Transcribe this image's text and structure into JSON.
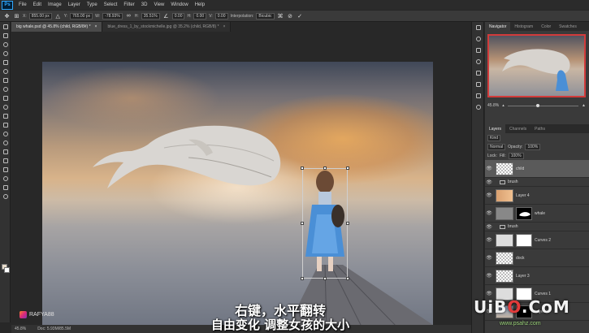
{
  "app": {
    "logo": "Ps",
    "accent": "#31a8ff"
  },
  "menu": [
    "File",
    "Edit",
    "Image",
    "Layer",
    "Type",
    "Select",
    "Filter",
    "3D",
    "View",
    "Window",
    "Help"
  ],
  "options": {
    "x_label": "X:",
    "x_value": "855.00 px",
    "y_label": "Y:",
    "y_value": "765.00 px",
    "w_label": "W:",
    "w_value": "-78.93%",
    "h_label": "H:",
    "h_value": "35.51%",
    "angle_value": "0.00",
    "h_skew_label": "H:",
    "h_skew_value": "0.00",
    "v_skew_label": "V:",
    "v_skew_value": "0.00",
    "interpolation_label": "Interpolation:",
    "interpolation_value": "Bicubic"
  },
  "doc_tabs": [
    {
      "label": "big whale.psd @ 45.8% (child, RGB/8#) *",
      "close": "×"
    },
    {
      "label": "blue_dress_1_by_stockmichelle.jpg @ 35.2% (child, RGB/8) *",
      "close": "×"
    }
  ],
  "panel_tabs_top": [
    "Navigator",
    "Histogram",
    "Color",
    "Swatches"
  ],
  "navigator": {
    "zoom": "45.8%"
  },
  "panel_tabs_layers": [
    "Layers",
    "Channels",
    "Paths"
  ],
  "layers_panel": {
    "kind": "Kind",
    "blend": "Normal",
    "opacity_label": "Opacity:",
    "opacity": "100%",
    "lock_label": "Lock:",
    "fill_label": "Fill:",
    "fill": "100%"
  },
  "layers": [
    {
      "name": "child",
      "kind": "layer",
      "selected": true
    },
    {
      "name": "brush",
      "kind": "group"
    },
    {
      "name": "Layer 4",
      "kind": "layer"
    },
    {
      "name": "whale",
      "kind": "layer-mask"
    },
    {
      "name": "brush",
      "kind": "group"
    },
    {
      "name": "Curves 2",
      "kind": "adjust-white"
    },
    {
      "name": "dock",
      "kind": "layer"
    },
    {
      "name": "Layer 3",
      "kind": "layer"
    },
    {
      "name": "Curves 1",
      "kind": "adjust-white"
    },
    {
      "name": "Layer 1",
      "kind": "layer-black"
    }
  ],
  "status": {
    "zoom": "45.8%",
    "doc": "Doc: 5.93M/85.5M"
  },
  "watermark_left": "RAFYA88",
  "subtitles": [
    "右键，水平翻转",
    "自由变化 调整女孩的大小"
  ],
  "watermark_right": {
    "brand_a": "UiB",
    "brand_o": "O",
    "brand_b": ".CoM",
    "url": "www.psahz.com"
  }
}
